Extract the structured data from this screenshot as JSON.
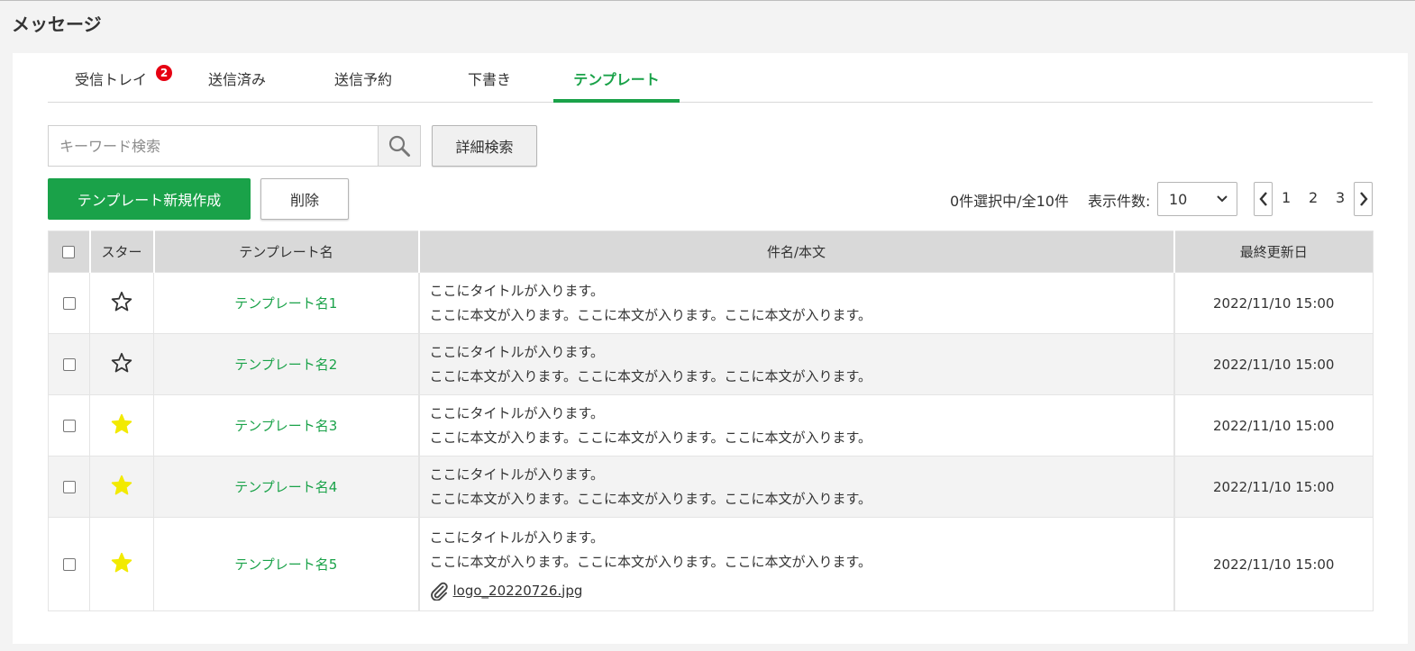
{
  "page": {
    "title": "メッセージ"
  },
  "tabs": [
    {
      "label": "受信トレイ",
      "badge": "2",
      "active": false
    },
    {
      "label": "送信済み",
      "active": false
    },
    {
      "label": "送信予約",
      "active": false
    },
    {
      "label": "下書き",
      "active": false
    },
    {
      "label": "テンプレート",
      "active": true
    }
  ],
  "search": {
    "placeholder": "キーワード検索",
    "value": "",
    "advanced_label": "詳細検索"
  },
  "actions": {
    "create_label": "テンプレート新規作成",
    "delete_label": "削除"
  },
  "status": {
    "selection": "0件選択中/全10件",
    "per_page_label": "表示件数:",
    "per_page_value": "10"
  },
  "pager": {
    "pages": [
      "1",
      "2",
      "3"
    ]
  },
  "table": {
    "headers": {
      "star": "スター",
      "name": "テンプレート名",
      "body": "件名/本文",
      "updated": "最終更新日"
    },
    "rows": [
      {
        "starred": false,
        "name": "テンプレート名1",
        "title": "ここにタイトルが入ります。",
        "body": "ここに本文が入ります。ここに本文が入ります。ここに本文が入ります。",
        "updated": "2022/11/10 15:00"
      },
      {
        "starred": false,
        "name": "テンプレート名2",
        "title": "ここにタイトルが入ります。",
        "body": "ここに本文が入ります。ここに本文が入ります。ここに本文が入ります。",
        "updated": "2022/11/10 15:00"
      },
      {
        "starred": true,
        "name": "テンプレート名3",
        "title": "ここにタイトルが入ります。",
        "body": "ここに本文が入ります。ここに本文が入ります。ここに本文が入ります。",
        "updated": "2022/11/10 15:00"
      },
      {
        "starred": true,
        "name": "テンプレート名4",
        "title": "ここにタイトルが入ります。",
        "body": "ここに本文が入ります。ここに本文が入ります。ここに本文が入ります。",
        "updated": "2022/11/10 15:00"
      },
      {
        "starred": true,
        "name": "テンプレート名5",
        "title": "ここにタイトルが入ります。",
        "body": "ここに本文が入ります。ここに本文が入ります。ここに本文が入ります。",
        "updated": "2022/11/10 15:00",
        "attachment": "logo_20220726.jpg"
      }
    ]
  },
  "colors": {
    "accent": "#1aa249",
    "badge": "#e60012",
    "star_filled": "#f2ea00",
    "header_bg": "#d9d9d9"
  }
}
